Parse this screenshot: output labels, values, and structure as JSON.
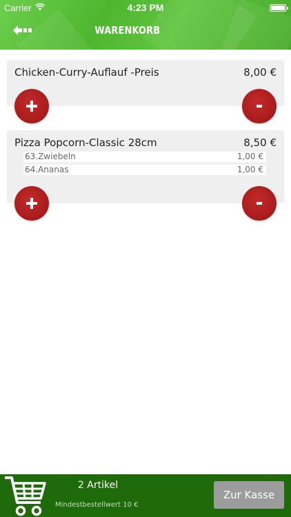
{
  "status_bar": {
    "carrier": "Carrier",
    "time": "4:23 PM"
  },
  "nav": {
    "title": "WARENKORB",
    "back_icon": "back-dots-arrow-icon"
  },
  "items": [
    {
      "name": "Chicken-Curry-Auflauf -Preis",
      "price": "8,00 €",
      "extras": []
    },
    {
      "name": "Pizza Popcorn-Classic 28cm",
      "price": "8,50 €",
      "extras": [
        {
          "name": "63.Zwiebeln",
          "price": "1,00 €"
        },
        {
          "name": "64.Ananas",
          "price": "1,00 €"
        }
      ]
    }
  ],
  "buttons": {
    "plus_icon": "plus-icon",
    "minus_icon": "minus-icon"
  },
  "footer": {
    "cart_icon": "shopping-cart-icon",
    "count_label": "2 Artikel",
    "min_order_label": "Mindestbestellwert 10 €",
    "checkout_label": "Zur Kasse"
  },
  "colors": {
    "header_green": "#55bb36",
    "footer_green": "#1f6b0b",
    "button_red": "#a81b1b",
    "checkout_gray": "#9c9c9c",
    "item_bg": "#efefef"
  }
}
